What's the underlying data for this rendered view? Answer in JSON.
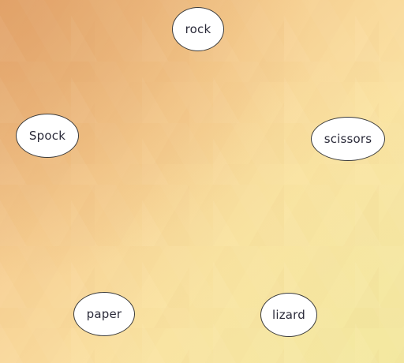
{
  "game": {
    "choices": [
      {
        "id": "rock",
        "label": "rock"
      },
      {
        "id": "scissors",
        "label": "scissors"
      },
      {
        "id": "lizard",
        "label": "lizard"
      },
      {
        "id": "paper",
        "label": "paper"
      },
      {
        "id": "spock",
        "label": "Spock"
      }
    ]
  },
  "colors": {
    "background_top_left": "#e7b07a",
    "background_bottom_right": "#f8ecae",
    "choice_fill": "#ffffff",
    "choice_border": "#3a3a3a",
    "choice_text": "#2b2b3a"
  }
}
